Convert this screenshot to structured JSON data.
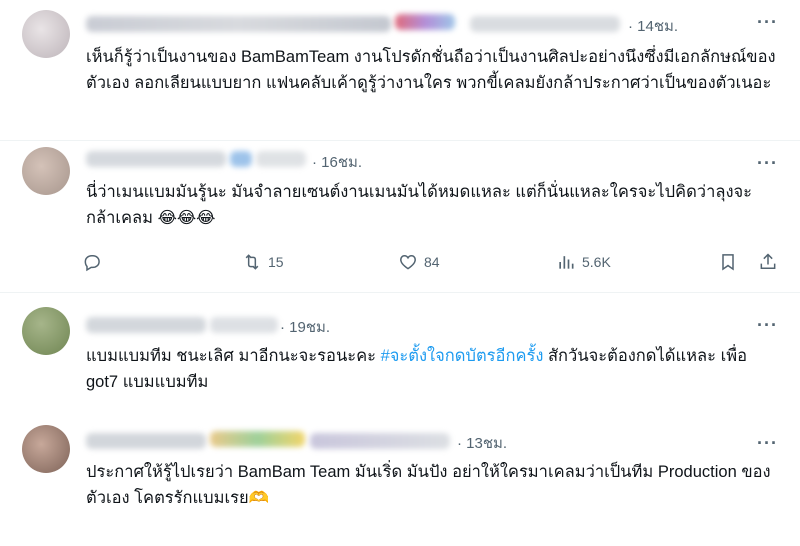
{
  "replies": [
    {
      "timestamp": "14ชม.",
      "text": "เห็นก็รู้ว่าเป็นงานของ BamBamTeam งานโปรดักชั่นถือว่าเป็นงานศิลปะอย่างนึงซึ่งมีเอกลักษณ์ของตัวเอง ลอกเลียนแบบยาก แฟนคลับเค้าดูรู้ว่างานใคร พวกขี้เคลมยังกล้าประกาศว่าเป็นของตัวเนอะ"
    },
    {
      "timestamp": "16ชม.",
      "text": "นี่ว่าเมนแบมมันรู้นะ มันจำลายเซนต์งานเมนมันได้หมดแหละ แต่ก็นั่นแหละใครจะไปคิดว่าลุงจะกล้าเคลม 😂😂😂",
      "actions": {
        "reply_count": "",
        "retweet_count": "15",
        "like_count": "84",
        "view_count": "5.6K"
      }
    },
    {
      "timestamp": "19ชม.",
      "text_before": "แบมแบมทีม ชนะเลิศ มาอีกนะจะรอนะคะ ",
      "hashtag": "#จะตั้งใจกดบัตรอีกครั้ง",
      "text_after": " สักวันจะต้องกดได้แหละ เพื่อ got7 แบมแบมทีม"
    },
    {
      "timestamp": "13ชม.",
      "text": "ประกาศให้รู้ไปเรยว่า BamBam Team มันเริ่ด มันปัง อย่าให้ใครมาเคลมว่าเป็นทีม Production ของตัวเอง โคตรรักแบมเรย🫶"
    }
  ],
  "more_icon": "more-horizontal-icon",
  "colors": {
    "text": "#0f1419",
    "secondary": "#536471",
    "hashtag": "#1d9bf0",
    "divider": "#eff3f4"
  }
}
